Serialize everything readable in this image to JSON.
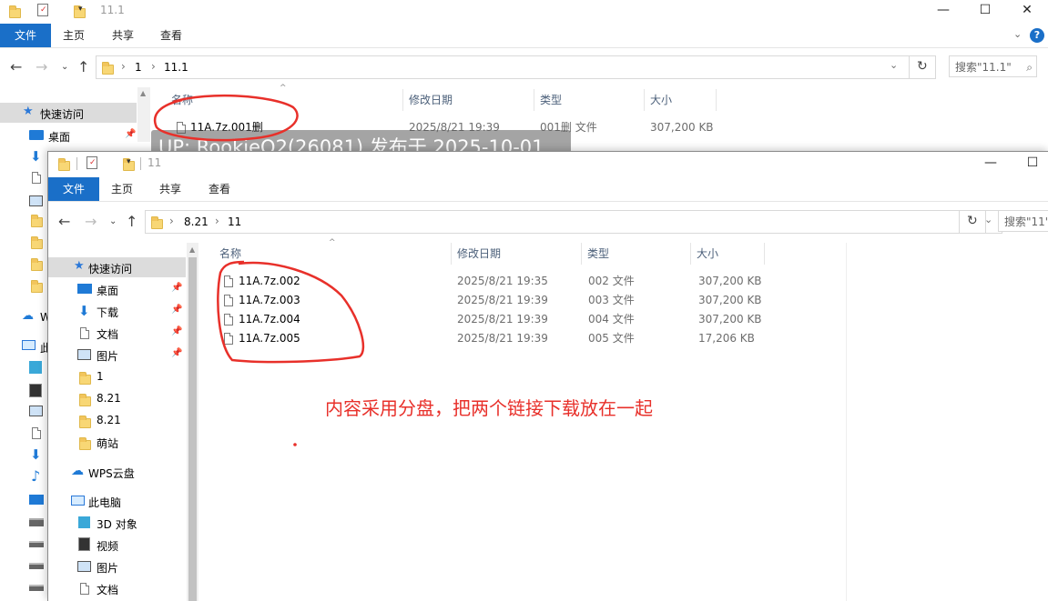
{
  "back_window": {
    "title": "11.1",
    "ribbon": {
      "file": "文件",
      "home": "主页",
      "share": "共享",
      "view": "查看"
    },
    "path": [
      "1",
      "11.1"
    ],
    "search_placeholder": "搜索\"11.1\"",
    "sidebar_quick_access": "快速访问",
    "sidebar_desktop": "桌面",
    "columns": {
      "name": "名称",
      "date": "修改日期",
      "type": "类型",
      "size": "大小"
    },
    "rows": [
      {
        "name": "11A.7z.001删",
        "date": "2025/8/21 19:39",
        "type": "001删 文件",
        "size": "307,200 KB"
      }
    ],
    "left_strip": {
      "wps": "W",
      "pc": "此"
    }
  },
  "watermark": "UP: RookieO2(26081) 发布于 2025-10-01",
  "front_window": {
    "title": "11",
    "ribbon": {
      "file": "文件",
      "home": "主页",
      "share": "共享",
      "view": "查看"
    },
    "path": [
      "8.21",
      "11"
    ],
    "search_placeholder": "搜索\"11\"",
    "columns": {
      "name": "名称",
      "date": "修改日期",
      "type": "类型",
      "size": "大小"
    },
    "rows": [
      {
        "name": "11A.7z.002",
        "date": "2025/8/21 19:35",
        "type": "002 文件",
        "size": "307,200 KB"
      },
      {
        "name": "11A.7z.003",
        "date": "2025/8/21 19:39",
        "type": "003 文件",
        "size": "307,200 KB"
      },
      {
        "name": "11A.7z.004",
        "date": "2025/8/21 19:39",
        "type": "004 文件",
        "size": "307,200 KB"
      },
      {
        "name": "11A.7z.005",
        "date": "2025/8/21 19:39",
        "type": "005 文件",
        "size": "17,206 KB"
      }
    ],
    "sidebar": {
      "quick_access": "快速访问",
      "items": [
        {
          "label": "桌面",
          "icon": "desktop-icon",
          "pinned": true
        },
        {
          "label": "下载",
          "icon": "download-icon",
          "pinned": true
        },
        {
          "label": "文档",
          "icon": "document-icon",
          "pinned": true
        },
        {
          "label": "图片",
          "icon": "picture-icon",
          "pinned": true
        },
        {
          "label": "1",
          "icon": "folder-icon",
          "pinned": false
        },
        {
          "label": "8.21",
          "icon": "folder-icon",
          "pinned": false
        },
        {
          "label": "8.21",
          "icon": "folder-icon",
          "pinned": false
        },
        {
          "label": "萌站",
          "icon": "folder-icon",
          "pinned": false
        }
      ],
      "wps_cloud": "WPS云盘",
      "this_pc": "此电脑",
      "pc_items": [
        {
          "label": "3D 对象",
          "icon": "3d-objects-icon"
        },
        {
          "label": "视频",
          "icon": "video-icon"
        },
        {
          "label": "图片",
          "icon": "picture-icon"
        },
        {
          "label": "文档",
          "icon": "document-icon"
        }
      ]
    }
  },
  "annotation": "内容采用分盘，把两个链接下载放在一起",
  "colors": {
    "accent": "#1a6fc8",
    "annotation": "#e8302a",
    "selected_bg": "#e5f3ff",
    "quick_bg": "#dcdcdc"
  }
}
